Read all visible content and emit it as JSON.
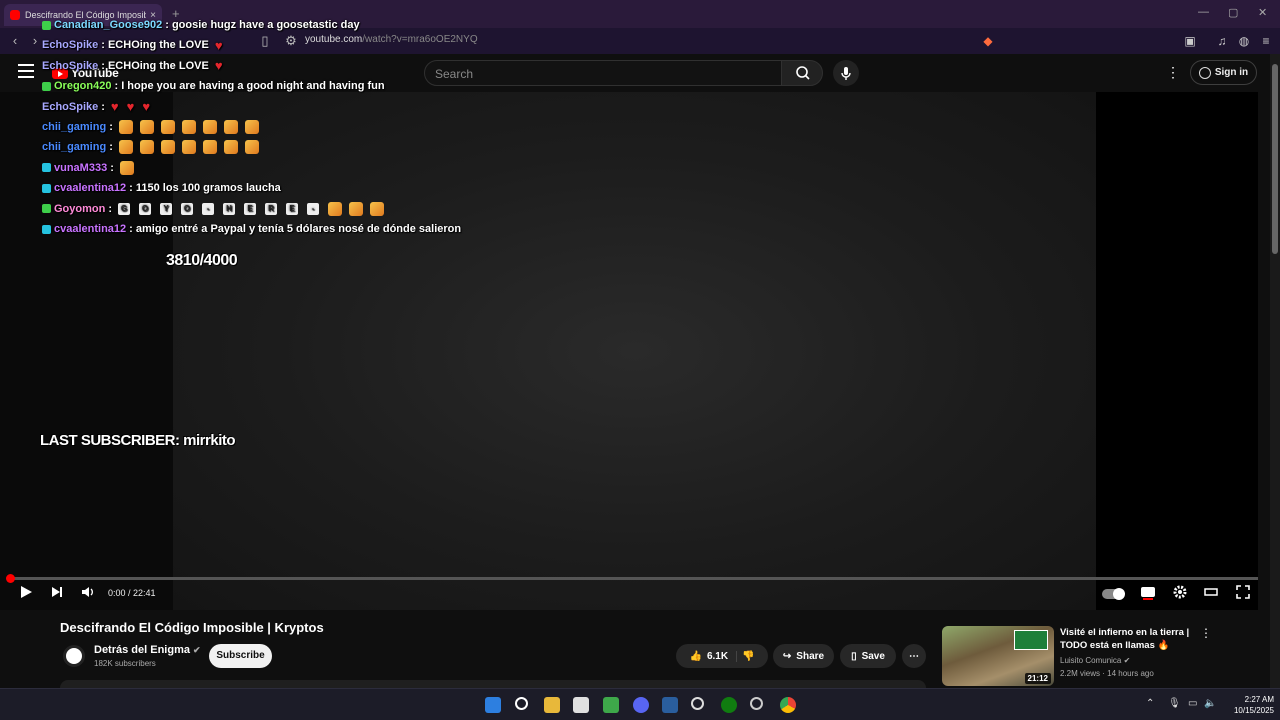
{
  "browser": {
    "tab_title": "Descifrando El Código Imposible",
    "tab_close": "×",
    "new_tab": "+",
    "url_host": "youtube.com",
    "url_path": "/watch?v=mra6oOE2NYQ",
    "window_controls": [
      "—",
      "▢",
      "✕"
    ]
  },
  "header": {
    "logo": "YouTube",
    "search_placeholder": "Search",
    "sign_in": "Sign in"
  },
  "chat": [
    {
      "user": "Canadian_Goose902",
      "color": "#7cd9ff",
      "badge": "#3ecf4a",
      "text": ": goosie hugz have a goosetastic day",
      "kind": "text"
    },
    {
      "user": "EchoSpike",
      "color": "#a8a8ff",
      "badge": "",
      "text": ": ECHOing the LOVE",
      "kind": "text-heart"
    },
    {
      "user": "EchoSpike",
      "color": "#a8a8ff",
      "badge": "",
      "text": ": ECHOing the LOVE",
      "kind": "text-heart"
    },
    {
      "user": "Oregon420",
      "color": "#8aff5a",
      "badge": "#3ecf4a",
      "text": ": I hope you are having a good night and having fun",
      "kind": "text"
    },
    {
      "user": "EchoSpike",
      "color": "#a8a8ff",
      "badge": "",
      "text": ":",
      "kind": "hearts"
    },
    {
      "user": "chii_gaming",
      "color": "#4a8aff",
      "badge": "",
      "text": ":",
      "kind": "emotes"
    },
    {
      "user": "chii_gaming",
      "color": "#4a8aff",
      "badge": "",
      "text": ":",
      "kind": "emotes"
    },
    {
      "user": "vunaM333",
      "color": "#c873ff",
      "badge": "#25c3e0",
      "text": ":",
      "kind": "emote1"
    },
    {
      "user": "cvaalentina12",
      "color": "#c873ff",
      "badge": "#25c3e0",
      "text": ": 1150 los 100 gramos laucha",
      "kind": "text"
    },
    {
      "user": "Goyomon",
      "color": "#ff8ad8",
      "badge": "#3ecf4a",
      "text": ":",
      "kind": "letters"
    },
    {
      "user": "cvaalentina12",
      "color": "#c873ff",
      "badge": "#25c3e0",
      "text": ": amigo entré a Paypal y tenía 5 dólares nosé de dónde salieron",
      "kind": "text"
    }
  ],
  "goyomon_letters": [
    "G",
    "O",
    "Y",
    "O",
    "-",
    "H",
    "E",
    "R",
    "E",
    "-"
  ],
  "overlay": {
    "goal": "3810/4000",
    "last_subscriber": "LAST SUBSCRIBER: mirrkito"
  },
  "player": {
    "time": "0:00 / 22:41",
    "progress": 0.0
  },
  "video": {
    "title": "Descifrando El Código Imposible | Kryptos",
    "channel": "Detrás del Enigma",
    "subscribers": "182K subscribers",
    "subscribe": "Subscribe",
    "likes": "6.1K",
    "share": "Share",
    "save": "Save"
  },
  "recommended": {
    "title": "Visité el infierno en la tierra | TODO está en llamas 🔥",
    "channel": "Luisito Comunica",
    "meta": "2.2M views · 14 hours ago",
    "duration": "21:12"
  },
  "taskbar": {
    "time": "2:27 AM",
    "date": "10/15/2025"
  }
}
